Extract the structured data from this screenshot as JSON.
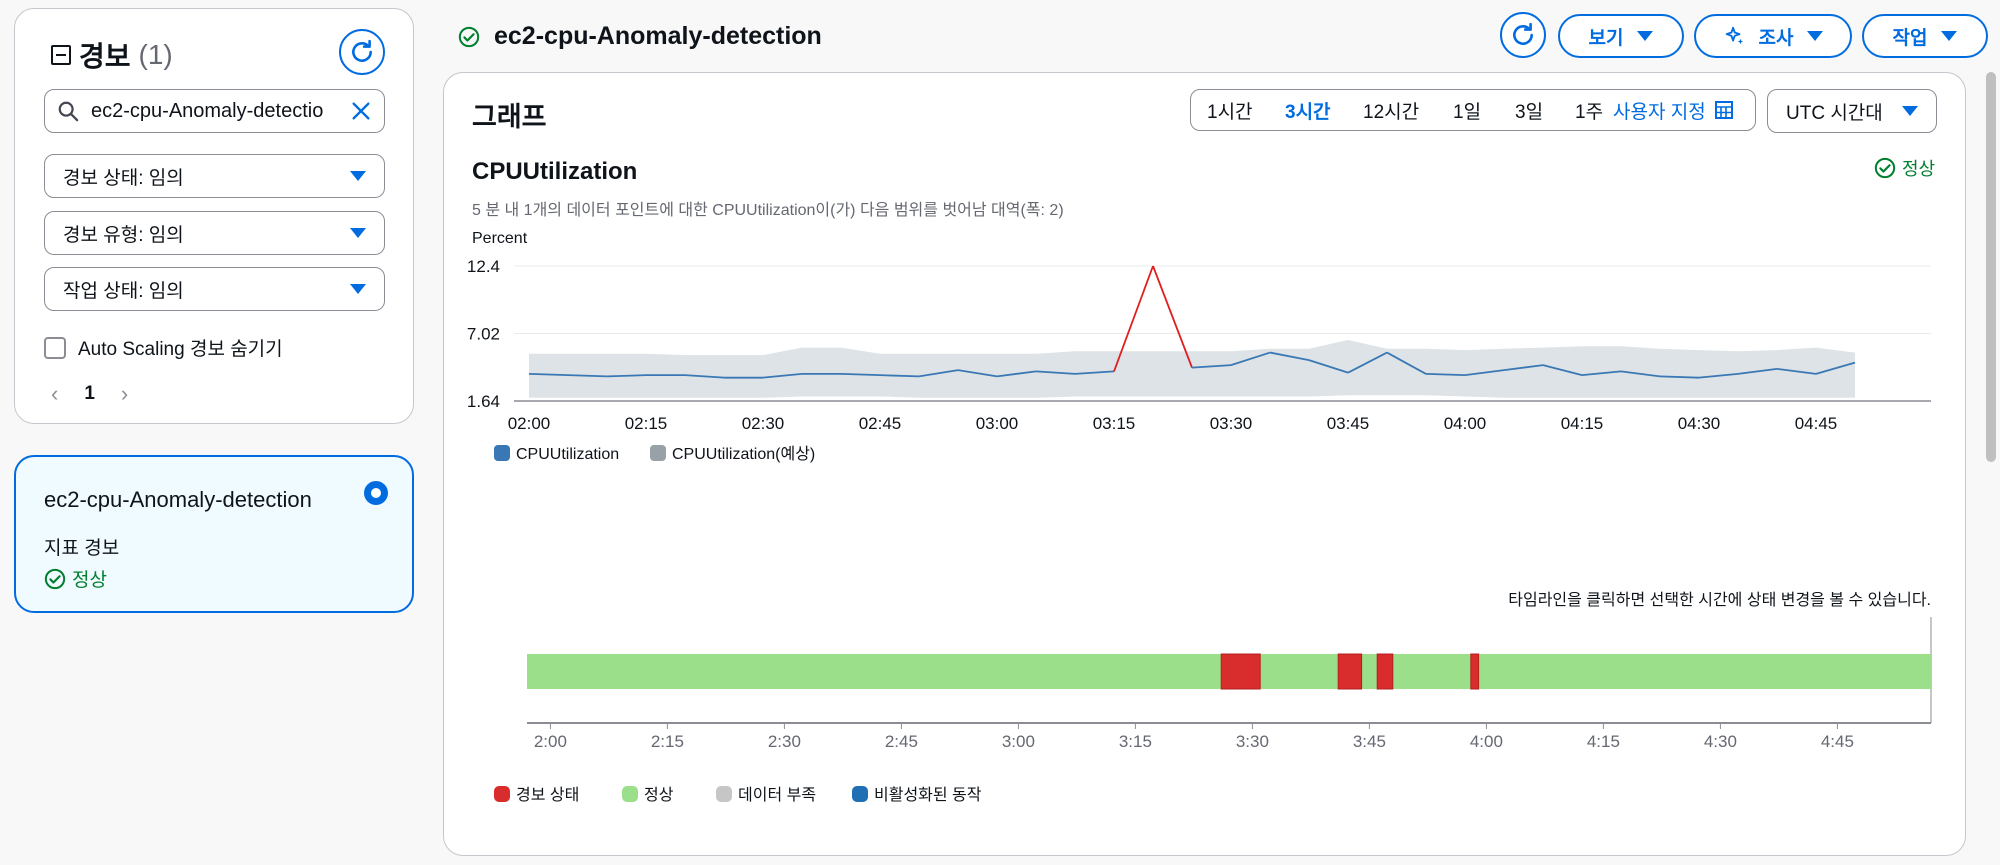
{
  "left_panel": {
    "title": "경보",
    "count": "(1)",
    "search": {
      "value": "ec2-cpu-Anomaly-detectio",
      "placeholder": ""
    },
    "filters": [
      {
        "label": "경보 상태: 임의"
      },
      {
        "label": "경보 유형: 임의"
      },
      {
        "label": "작업 상태: 임의"
      }
    ],
    "hide_autoscaling_label": "Auto Scaling 경보 숨기기",
    "page": "1"
  },
  "alarm_card": {
    "name": "ec2-cpu-Anomaly-detection",
    "type": "지표 경보",
    "status": "정상"
  },
  "header": {
    "title": "ec2-cpu-Anomaly-detection",
    "buttons": {
      "view": "보기",
      "investigate": "조사",
      "action": "작업"
    }
  },
  "graph_panel": {
    "heading": "그래프",
    "time_ranges": [
      "1시간",
      "3시간",
      "12시간",
      "1일",
      "3일",
      "1주"
    ],
    "active_range": "3시간",
    "custom_label": "사용자 지정",
    "timezone": "UTC 시간대",
    "metric_title": "CPUUtilization",
    "metric_description": "5 분 내 1개의 데이터 포인트에 대한 CPUUtilization이(가) 다음 범위를 벗어남 대역(폭: 2)",
    "status": "정상",
    "timeline_hint": "타임라인을 클릭하면 선택한 시간에 상태 변경을 볼 수 있습니다."
  },
  "colors": {
    "accent": "#006ce0",
    "ok": "#00802f",
    "series_actual": "#3a78b5",
    "series_breach": "#e02020",
    "band": "#dde3e6",
    "timeline_ok": "#9bdf8a",
    "timeline_alarm": "#d92d2d"
  },
  "chart_data": [
    {
      "type": "line",
      "title": "CPUUtilization",
      "ylabel": "Percent",
      "xlabel": "",
      "ylim": [
        1.64,
        12.4
      ],
      "yticks": [
        "12.4",
        "7.02",
        "1.64"
      ],
      "xticks": [
        "02:00",
        "02:15",
        "02:30",
        "02:45",
        "03:00",
        "03:15",
        "03:30",
        "03:45",
        "04:00",
        "04:15",
        "04:30",
        "04:45"
      ],
      "x": [
        "02:00",
        "02:05",
        "02:10",
        "02:15",
        "02:20",
        "02:25",
        "02:30",
        "02:35",
        "02:40",
        "02:45",
        "02:50",
        "02:55",
        "03:00",
        "03:05",
        "03:10",
        "03:15",
        "03:20",
        "03:25",
        "03:30",
        "03:35",
        "03:40",
        "03:45",
        "03:50",
        "03:55",
        "04:00",
        "04:05",
        "04:10",
        "04:15",
        "04:20",
        "04:25",
        "04:30",
        "04:35",
        "04:40",
        "04:45",
        "04:50"
      ],
      "series": [
        {
          "name": "CPUUtilization",
          "values": [
            3.8,
            3.7,
            3.6,
            3.7,
            3.7,
            3.5,
            3.5,
            3.8,
            3.8,
            3.7,
            3.6,
            4.1,
            3.6,
            4.0,
            3.8,
            4.0,
            12.4,
            4.3,
            4.5,
            5.5,
            4.9,
            3.9,
            5.5,
            3.8,
            3.7,
            4.1,
            4.5,
            3.7,
            4.0,
            3.6,
            3.5,
            3.8,
            4.2,
            3.8,
            4.7
          ]
        },
        {
          "name": "CPUUtilization(예상)",
          "upper": [
            5.4,
            5.4,
            5.4,
            5.4,
            5.3,
            5.3,
            5.3,
            5.9,
            5.9,
            5.4,
            5.4,
            5.4,
            5.4,
            5.4,
            5.6,
            5.6,
            5.6,
            5.6,
            5.6,
            5.8,
            5.8,
            6.5,
            5.8,
            5.8,
            5.7,
            5.8,
            5.9,
            6.0,
            6.0,
            5.8,
            5.7,
            5.6,
            5.7,
            5.9,
            5.5
          ],
          "lower": [
            1.9,
            1.9,
            1.9,
            1.9,
            1.9,
            1.9,
            1.9,
            2.0,
            2.0,
            2.0,
            1.9,
            1.9,
            1.9,
            1.9,
            2.0,
            2.0,
            2.0,
            2.0,
            2.0,
            2.0,
            2.0,
            2.1,
            2.1,
            2.1,
            2.0,
            1.9,
            1.9,
            1.9,
            1.9,
            1.9,
            1.9,
            1.9,
            1.9,
            1.9,
            1.9
          ]
        }
      ],
      "legend": [
        "CPUUtilization",
        "CPUUtilization(예상)"
      ],
      "legend_position": "bottom-left",
      "grid": true
    },
    {
      "type": "timeline",
      "xticks": [
        "2:00",
        "2:15",
        "2:30",
        "2:45",
        "3:00",
        "3:15",
        "3:30",
        "3:45",
        "4:00",
        "4:15",
        "4:30",
        "4:45"
      ],
      "range": [
        "01:57",
        "04:57"
      ],
      "default_state": "정상",
      "alarm_intervals": [
        [
          "03:26",
          "03:31"
        ],
        [
          "03:41",
          "03:44"
        ],
        [
          "03:46",
          "03:48"
        ],
        [
          "03:58",
          "03:59"
        ]
      ],
      "legend": [
        "경보 상태",
        "정상",
        "데이터 부족",
        "비활성화된 동작"
      ],
      "legend_colors": [
        "#d92d2d",
        "#9bdf8a",
        "#c6c6c6",
        "#1f6fb5"
      ],
      "legend_position": "bottom-left"
    }
  ]
}
